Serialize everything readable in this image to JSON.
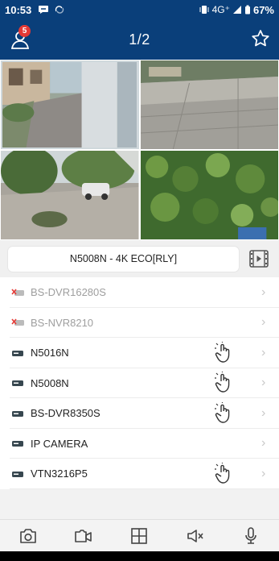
{
  "status_bar": {
    "time": "10:53",
    "network": "4G⁺",
    "battery": "67%"
  },
  "header": {
    "title": "1/2",
    "notification_count": "5",
    "user_icon": "user-icon",
    "favorite_icon": "star-outline-icon"
  },
  "cameras": [
    {
      "name": "camera-1",
      "scene": "driveway-building"
    },
    {
      "name": "camera-2",
      "scene": "courtyard-pavement"
    },
    {
      "name": "camera-3",
      "scene": "garden-with-car"
    },
    {
      "name": "camera-4",
      "scene": "foliage-closeup"
    }
  ],
  "device_selector": {
    "value": "N5008N - 4K ECO[RLY]",
    "playback_icon": "film-playback-icon"
  },
  "devices": [
    {
      "name": "BS-DVR16280S",
      "status": "offline",
      "hand": false
    },
    {
      "name": "BS-NVR8210",
      "status": "offline",
      "hand": false
    },
    {
      "name": "N5016N",
      "status": "online",
      "hand": true
    },
    {
      "name": "N5008N",
      "status": "online",
      "hand": true
    },
    {
      "name": "BS-DVR8350S",
      "status": "online",
      "hand": true
    },
    {
      "name": "IP CAMERA",
      "status": "online",
      "hand": false
    },
    {
      "name": "VTN3216P5",
      "status": "online",
      "hand": true
    }
  ],
  "toolbar": {
    "snapshot_icon": "camera-icon",
    "record_icon": "video-record-icon",
    "layout_icon": "grid-layout-icon",
    "mute_icon": "speaker-mute-icon",
    "mic_icon": "microphone-icon"
  },
  "colors": {
    "header_bg": "#0a3f7a",
    "badge": "#e53935",
    "offline_icon": "#e53935"
  }
}
